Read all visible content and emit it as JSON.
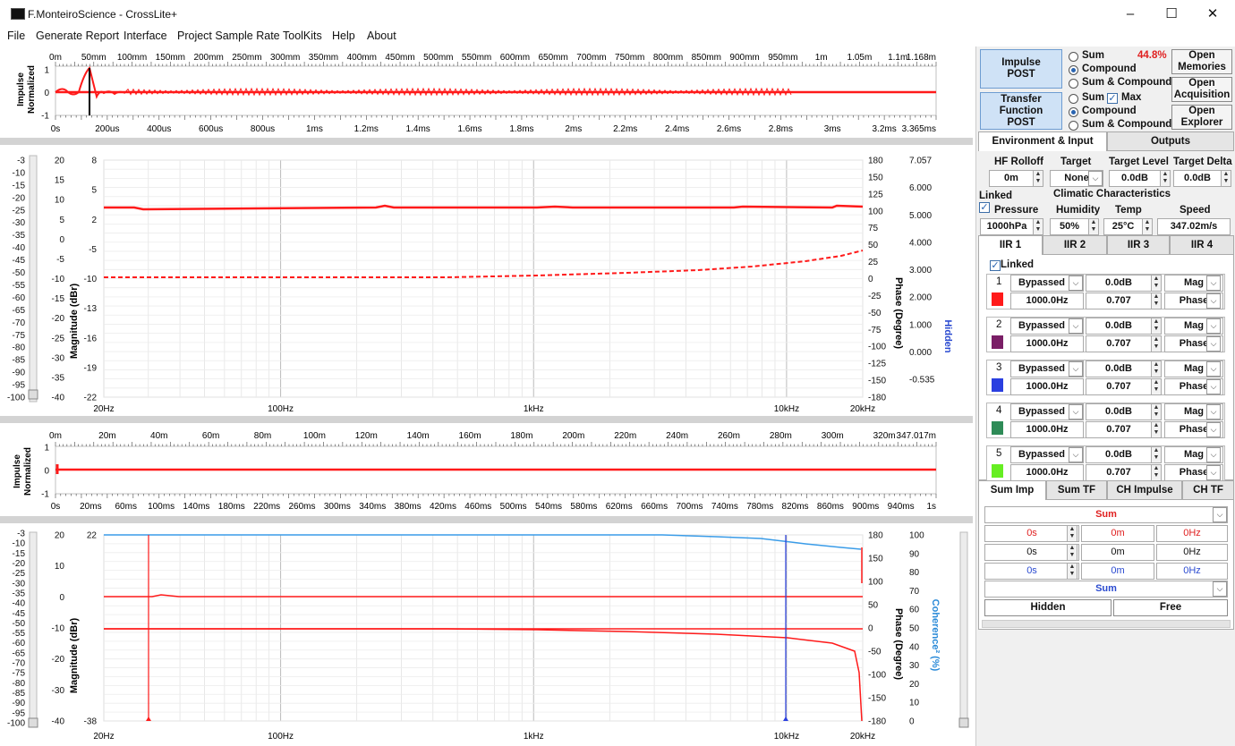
{
  "app": {
    "title": "F.MonteiroScience - CrossLite+",
    "min_glyph": "–",
    "max_glyph": "☐",
    "close_glyph": "✕"
  },
  "menu": [
    "File",
    "Generate Report",
    "Interface",
    "Project Sample Rate",
    "ToolKits",
    "Help",
    "About"
  ],
  "top_impulse": {
    "ylabel": "Impulse\nNormalized",
    "top_ticks": [
      "0m",
      "50mm",
      "100mm",
      "150mm",
      "200mm",
      "250mm",
      "300mm",
      "350mm",
      "400mm",
      "450mm",
      "500mm",
      "550mm",
      "600mm",
      "650mm",
      "700mm",
      "750mm",
      "800mm",
      "850mm",
      "900mm",
      "950mm",
      "1m",
      "1.05m",
      "1.1m",
      "1.168m"
    ],
    "bottom_ticks": [
      "0s",
      "200us",
      "400us",
      "600us",
      "800us",
      "1ms",
      "1.2ms",
      "1.4ms",
      "1.6ms",
      "1.8ms",
      "2ms",
      "2.2ms",
      "2.4ms",
      "2.6ms",
      "2.8ms",
      "3ms",
      "3.2ms",
      "3.365ms"
    ],
    "y_ticks": [
      "1",
      "0",
      "-1"
    ]
  },
  "top_tf": {
    "outer_ticks": [
      "-3",
      "-10",
      "-15",
      "-20",
      "-25",
      "-30",
      "-35",
      "-40",
      "-45",
      "-50",
      "-55",
      "-60",
      "-65",
      "-70",
      "-75",
      "-80",
      "-85",
      "-90",
      "-95",
      "-100"
    ],
    "mag_ticks": [
      "20",
      "15",
      "10",
      "5",
      "0",
      "-5",
      "-10",
      "-15",
      "-20",
      "-25",
      "-30",
      "-35",
      "-40"
    ],
    "mag2_ticks": [
      "8",
      "5",
      "2",
      "-5",
      "-10",
      "-13",
      "-16",
      "-19",
      "-22"
    ],
    "phase_ticks": [
      "180",
      "150",
      "125",
      "100",
      "75",
      "50",
      "25",
      "0",
      "-25",
      "-50",
      "-75",
      "-100",
      "-125",
      "-150",
      "-180"
    ],
    "right_ticks": [
      "7.057",
      "6.000",
      "5.000",
      "4.000",
      "3.000",
      "2.000",
      "1.000",
      "0.000",
      "-0.535"
    ],
    "x_ticks": [
      "20Hz",
      "100Hz",
      "1kHz",
      "10kHz",
      "20kHz"
    ],
    "ylabel": "Magnitude (dBr)",
    "ylabel_right": "Phase (Degree)",
    "hidden_label": "Hidden"
  },
  "mid_impulse": {
    "ylabel": "Impulse\nNormalized",
    "top_ticks": [
      "0m",
      "20m",
      "40m",
      "60m",
      "80m",
      "100m",
      "120m",
      "140m",
      "160m",
      "180m",
      "200m",
      "220m",
      "240m",
      "260m",
      "280m",
      "300m",
      "320m",
      "347.017m"
    ],
    "bottom_ticks": [
      "0s",
      "20ms",
      "60ms",
      "100ms",
      "140ms",
      "180ms",
      "220ms",
      "260ms",
      "300ms",
      "340ms",
      "380ms",
      "420ms",
      "460ms",
      "500ms",
      "540ms",
      "580ms",
      "620ms",
      "660ms",
      "700ms",
      "740ms",
      "780ms",
      "820ms",
      "860ms",
      "900ms",
      "940ms",
      "1s"
    ],
    "y_ticks": [
      "1",
      "0",
      "-1"
    ]
  },
  "bot_tf": {
    "outer_ticks": [
      "-3",
      "-10",
      "-15",
      "-20",
      "-25",
      "-30",
      "-35",
      "-40",
      "-45",
      "-50",
      "-55",
      "-60",
      "-65",
      "-70",
      "-75",
      "-80",
      "-85",
      "-90",
      "-95",
      "-100"
    ],
    "mag_ticks": [
      "20",
      "10",
      "0",
      "-10",
      "-20",
      "-30",
      "-40"
    ],
    "mag2_ticks": [
      "22",
      "-38"
    ],
    "phase_ticks": [
      "180",
      "150",
      "100",
      "50",
      "0",
      "-50",
      "-100",
      "-150",
      "-180"
    ],
    "coh_ticks": [
      "100",
      "90",
      "80",
      "70",
      "60",
      "50",
      "40",
      "30",
      "20",
      "10",
      "0"
    ],
    "x_ticks": [
      "20Hz",
      "100Hz",
      "1kHz",
      "10kHz",
      "20kHz"
    ],
    "ylabel": "Magnitude (dBr)",
    "ylabel_right": "Phase (Degree)",
    "coh_label": "Coherence² (%)"
  },
  "panel": {
    "impulse_btn": "Impulse\nPOST",
    "tf_btn": "Transfer\nFunction\nPOST",
    "radio1": [
      "Sum",
      "Compound",
      "Sum & Compound"
    ],
    "radio1_sel": 1,
    "radio2": [
      "Sum",
      "Compound",
      "Sum & Compound"
    ],
    "radio2_sel": 1,
    "percent": "44.8%",
    "max_label": "Max",
    "open_memories": "Open\nMemories",
    "open_acquisition": "Open\nAcquisition",
    "open_explorer": "Open\nExplorer",
    "tabs1": [
      "Environment & Input",
      "Outputs"
    ],
    "env_headers": [
      "HF Rolloff",
      "Target",
      "Target Level",
      "Target Delta"
    ],
    "env_values": [
      "0m",
      "None",
      "0.0dB",
      "0.0dB"
    ],
    "linked": "Linked",
    "climatic": "Climatic Characteristics",
    "clim_headers": [
      "Pressure",
      "Humidity",
      "Temp",
      "Speed"
    ],
    "clim_values": [
      "1000hPa",
      "50%",
      "25°C",
      "347.02m/s"
    ],
    "iir_tabs": [
      "IIR 1",
      "IIR 2",
      "IIR 3",
      "IIR 4"
    ],
    "iir_linked": "Linked",
    "filters": [
      {
        "n": "1",
        "type": "Bypassed",
        "gain": "0.0dB",
        "mode": "Mag",
        "freq": "1000.0Hz",
        "q": "0.707",
        "mode2": "Phase",
        "color": "#ff1a1a"
      },
      {
        "n": "2",
        "type": "Bypassed",
        "gain": "0.0dB",
        "mode": "Mag",
        "freq": "1000.0Hz",
        "q": "0.707",
        "mode2": "Phase",
        "color": "#7a1e66"
      },
      {
        "n": "3",
        "type": "Bypassed",
        "gain": "0.0dB",
        "mode": "Mag",
        "freq": "1000.0Hz",
        "q": "0.707",
        "mode2": "Phase",
        "color": "#2a3fe0"
      },
      {
        "n": "4",
        "type": "Bypassed",
        "gain": "0.0dB",
        "mode": "Mag",
        "freq": "1000.0Hz",
        "q": "0.707",
        "mode2": "Phase",
        "color": "#2e8b57"
      },
      {
        "n": "5",
        "type": "Bypassed",
        "gain": "0.0dB",
        "mode": "Mag",
        "freq": "1000.0Hz",
        "q": "0.707",
        "mode2": "Phase",
        "color": "#66ee22"
      }
    ],
    "tabs2": [
      "Sum Imp",
      "Sum TF",
      "CH Impulse",
      "CH TF"
    ],
    "sum_select": "Sum",
    "cursor_rows": [
      [
        "0s",
        "0m",
        "0Hz"
      ],
      [
        "0s",
        "0m",
        "0Hz"
      ],
      [
        "0s",
        "0m",
        "0Hz"
      ]
    ],
    "sum_select2": "Sum",
    "hidden_btn": "Hidden",
    "free_btn": "Free"
  }
}
